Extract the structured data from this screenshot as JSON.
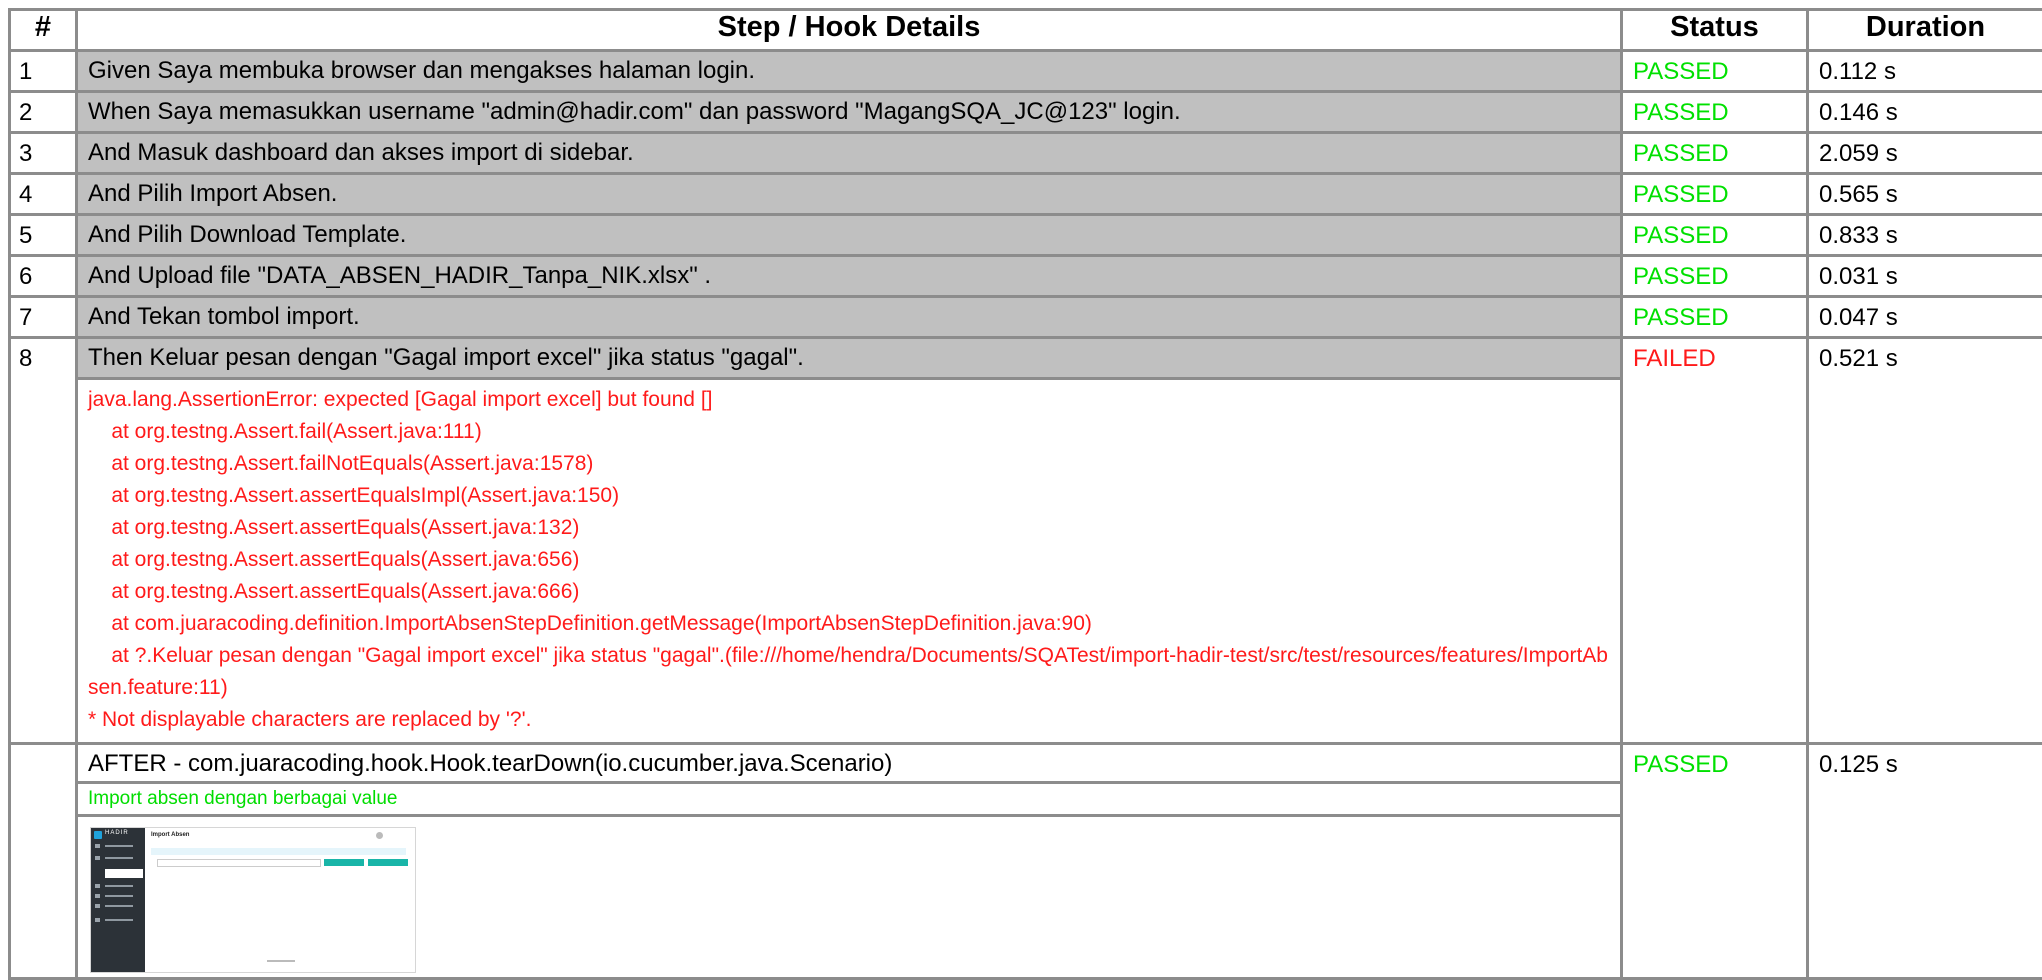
{
  "headers": {
    "num": "#",
    "step": "Step / Hook Details",
    "status": "Status",
    "duration": "Duration"
  },
  "steps": [
    {
      "num": "1",
      "text": "Given Saya membuka browser dan mengakses halaman login.",
      "status": "PASSED",
      "duration": "0.112 s"
    },
    {
      "num": "2",
      "text": "When Saya memasukkan username \"admin@hadir.com\" dan password \"MagangSQA_JC@123\" login.",
      "status": "PASSED",
      "duration": "0.146 s"
    },
    {
      "num": "3",
      "text": "And Masuk dashboard dan akses import di sidebar.",
      "status": "PASSED",
      "duration": "2.059 s"
    },
    {
      "num": "4",
      "text": "And Pilih Import Absen.",
      "status": "PASSED",
      "duration": "0.565 s"
    },
    {
      "num": "5",
      "text": "And Pilih Download Template.",
      "status": "PASSED",
      "duration": "0.833 s"
    },
    {
      "num": "6",
      "text": "And Upload file \"DATA_ABSEN_HADIR_Tanpa_NIK.xlsx\" .",
      "status": "PASSED",
      "duration": "0.031 s"
    },
    {
      "num": "7",
      "text": "And Tekan tombol import.",
      "status": "PASSED",
      "duration": "0.047 s"
    },
    {
      "num": "8",
      "text": "Then Keluar pesan dengan \"Gagal import excel\" jika status \"gagal\".",
      "status": "FAILED",
      "duration": "0.521 s"
    }
  ],
  "error": {
    "lines": [
      "java.lang.AssertionError: expected [Gagal import excel] but found []",
      "    at org.testng.Assert.fail(Assert.java:111)",
      "    at org.testng.Assert.failNotEquals(Assert.java:1578)",
      "    at org.testng.Assert.assertEqualsImpl(Assert.java:150)",
      "    at org.testng.Assert.assertEquals(Assert.java:132)",
      "    at org.testng.Assert.assertEquals(Assert.java:656)",
      "    at org.testng.Assert.assertEquals(Assert.java:666)",
      "    at com.juaracoding.definition.ImportAbsenStepDefinition.getMessage(ImportAbsenStepDefinition.java:90)"
    ],
    "wrapped_line": "    at ?.Keluar pesan dengan \"Gagal import excel\" jika status \"gagal\".(file:///home/hendra/Documents/SQATest/import-hadir-test/src/test/resources/features/ImportAbsen.feature:11)",
    "note": "* Not displayable characters are replaced by '?'."
  },
  "hook": {
    "num": "",
    "text": "AFTER - com.juaracoding.hook.Hook.tearDown(io.cucumber.java.Scenario)",
    "status": "PASSED",
    "duration": "0.125 s",
    "output": "Import absen dengan berbagai value",
    "screenshot": {
      "brand": "HADIR",
      "page_title": "Import Absen"
    }
  },
  "colors": {
    "passed": "#00e000",
    "failed": "#ff1a1a",
    "step_bg": "#c0c0c0",
    "border": "#8c8c8c"
  }
}
